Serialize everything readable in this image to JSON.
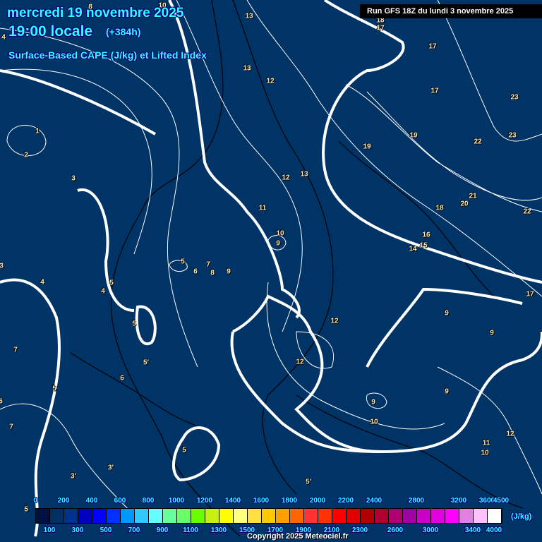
{
  "header": {
    "date": "mercredi 19 novembre 2025",
    "time": "19:00 locale",
    "lead": "(+384h)",
    "parameter": "Surface-Based CAPE (J/kg) et Lifted Index",
    "run": "Run GFS 18Z du lundi 3 novembre 2025"
  },
  "legend": {
    "unit": "(J/kg)",
    "top_labels": [
      "0",
      "200",
      "400",
      "600",
      "800",
      "1000",
      "1200",
      "1400",
      "1600",
      "1800",
      "2000",
      "2200",
      "2400",
      "2800",
      "3200",
      "3600",
      "4500"
    ],
    "bottom_labels": [
      "100",
      "300",
      "500",
      "700",
      "900",
      "1100",
      "1300",
      "1500",
      "1700",
      "1900",
      "2100",
      "2300",
      "2600",
      "3000",
      "3400",
      "4000"
    ],
    "colors": [
      "#001040",
      "#003060",
      "#003090",
      "#0000c0",
      "#0000ff",
      "#0030ff",
      "#0098ff",
      "#30c8ff",
      "#66ffff",
      "#66ff99",
      "#66ff66",
      "#66ff00",
      "#c8f010",
      "#ffff00",
      "#ffff80",
      "#ffe040",
      "#ffc800",
      "#ffa000",
      "#ff6600",
      "#ff3333",
      "#ff3300",
      "#ff0000",
      "#e00000",
      "#b00000",
      "#b00030",
      "#b00070",
      "#a000a0",
      "#c800c8",
      "#e000e0",
      "#ff00ff",
      "#e080e0",
      "#ffc0ff",
      "#ffffff"
    ]
  },
  "lifted_index_labels": [
    "8",
    "10",
    "13",
    "4",
    "13",
    "12",
    "18",
    "17",
    "17",
    "17",
    "23",
    "1",
    "2",
    "19",
    "23",
    "22",
    "19",
    "3",
    "12",
    "13",
    "11",
    "21",
    "20",
    "18",
    "22",
    "10",
    "9",
    "16",
    "14",
    "15",
    "5",
    "7",
    "6",
    "8",
    "9",
    "3",
    "4",
    "5",
    "4",
    "17",
    "9",
    "12",
    "5",
    "9",
    "7",
    "5'",
    "12",
    "6",
    "5",
    "9",
    "9",
    "6",
    "10",
    "7",
    "12",
    "5",
    "11",
    "10",
    "3'",
    "3'",
    "5'",
    "5"
  ],
  "footer": {
    "copyright": "Copyright 2025 Meteociel.fr"
  }
}
